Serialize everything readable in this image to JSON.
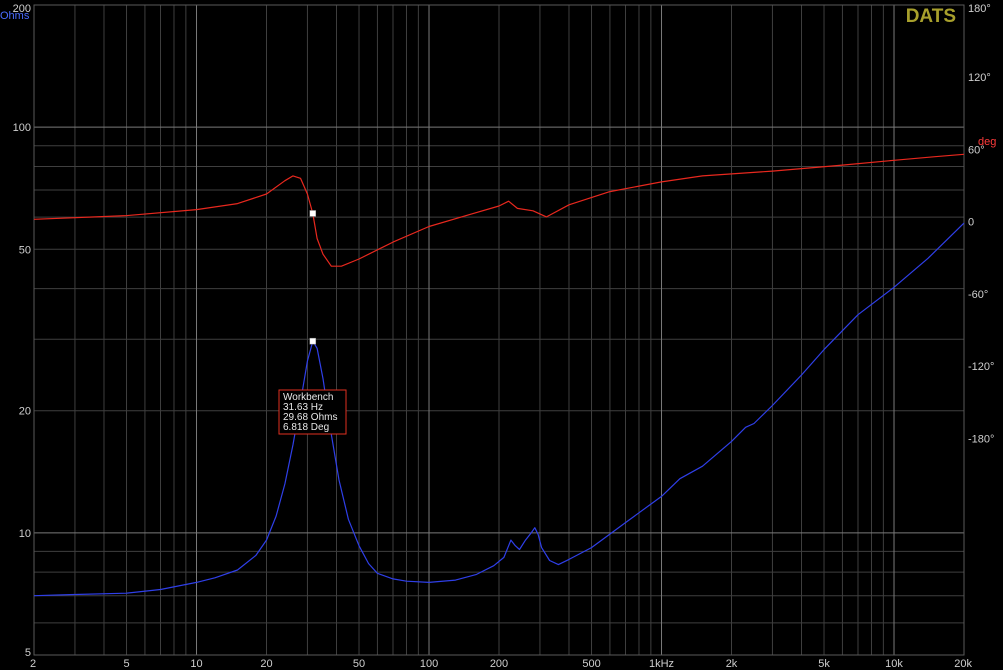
{
  "brand": "DATS",
  "units": {
    "left": "Ohms",
    "right": "deg"
  },
  "chart_data": {
    "type": "line",
    "xscale": "log",
    "xlim": [
      2,
      20000
    ],
    "x_ticks": [
      {
        "v": 2,
        "label": "2"
      },
      {
        "v": 5,
        "label": "5"
      },
      {
        "v": 10,
        "label": "10"
      },
      {
        "v": 20,
        "label": "20"
      },
      {
        "v": 50,
        "label": "50"
      },
      {
        "v": 100,
        "label": "100"
      },
      {
        "v": 200,
        "label": "200"
      },
      {
        "v": 500,
        "label": "500"
      },
      {
        "v": 1000,
        "label": "1kHz"
      },
      {
        "v": 2000,
        "label": "2k"
      },
      {
        "v": 5000,
        "label": "5k"
      },
      {
        "v": 10000,
        "label": "10k"
      },
      {
        "v": 20000,
        "label": "20k"
      }
    ],
    "y_left": {
      "scale": "log",
      "lim": [
        5,
        200
      ],
      "unit": "Ohms",
      "ticks": [
        {
          "v": 200,
          "label": "200"
        },
        {
          "v": 100,
          "label": "100"
        },
        {
          "v": 50,
          "label": "50"
        },
        {
          "v": 20,
          "label": "20"
        },
        {
          "v": 10,
          "label": "10"
        },
        {
          "v": 5,
          "label": "5"
        }
      ]
    },
    "y_right": {
      "scale": "linear",
      "lim": [
        -360,
        180
      ],
      "unit": "deg",
      "ticks": [
        {
          "v": 180,
          "label": "180°"
        },
        {
          "v": 120,
          "label": "120°"
        },
        {
          "v": 60,
          "label": "60°"
        },
        {
          "v": 0,
          "label": "0"
        },
        {
          "v": -60,
          "label": "-60°"
        },
        {
          "v": -120,
          "label": "-120°"
        },
        {
          "v": -180,
          "label": "-180°"
        }
      ]
    },
    "grid": true,
    "series": [
      {
        "name": "Impedance",
        "axis": "left",
        "color": "#2f3fe8",
        "points": [
          [
            2,
            7.0
          ],
          [
            3,
            7.05
          ],
          [
            5,
            7.1
          ],
          [
            7,
            7.25
          ],
          [
            10,
            7.55
          ],
          [
            12,
            7.75
          ],
          [
            15,
            8.1
          ],
          [
            18,
            8.8
          ],
          [
            20,
            9.6
          ],
          [
            22,
            11.0
          ],
          [
            24,
            13.2
          ],
          [
            26,
            16.5
          ],
          [
            28,
            21.0
          ],
          [
            30,
            26.5
          ],
          [
            31.63,
            29.68
          ],
          [
            33,
            28.5
          ],
          [
            35,
            24.0
          ],
          [
            38,
            17.5
          ],
          [
            41,
            13.5
          ],
          [
            45,
            10.8
          ],
          [
            50,
            9.3
          ],
          [
            55,
            8.4
          ],
          [
            60,
            7.95
          ],
          [
            70,
            7.7
          ],
          [
            80,
            7.6
          ],
          [
            100,
            7.55
          ],
          [
            130,
            7.65
          ],
          [
            160,
            7.9
          ],
          [
            190,
            8.3
          ],
          [
            210,
            8.7
          ],
          [
            225,
            9.6
          ],
          [
            235,
            9.3
          ],
          [
            245,
            9.1
          ],
          [
            260,
            9.6
          ],
          [
            275,
            10.0
          ],
          [
            285,
            10.3
          ],
          [
            295,
            9.9
          ],
          [
            305,
            9.2
          ],
          [
            330,
            8.55
          ],
          [
            360,
            8.35
          ],
          [
            400,
            8.6
          ],
          [
            500,
            9.2
          ],
          [
            700,
            10.6
          ],
          [
            1000,
            12.3
          ],
          [
            1200,
            13.6
          ],
          [
            1500,
            14.6
          ],
          [
            2000,
            16.8
          ],
          [
            2300,
            18.2
          ],
          [
            2500,
            18.6
          ],
          [
            3000,
            20.6
          ],
          [
            4000,
            24.5
          ],
          [
            5000,
            28.3
          ],
          [
            7000,
            34.5
          ],
          [
            10000,
            40.3
          ],
          [
            14000,
            47.5
          ],
          [
            20000,
            58.0
          ]
        ]
      },
      {
        "name": "Phase",
        "axis": "right",
        "color": "#e8281e",
        "points": [
          [
            2,
            2
          ],
          [
            5,
            5
          ],
          [
            10,
            10
          ],
          [
            15,
            15
          ],
          [
            20,
            23
          ],
          [
            24,
            34
          ],
          [
            26,
            38
          ],
          [
            28,
            36
          ],
          [
            30,
            23
          ],
          [
            31.63,
            6.8
          ],
          [
            33,
            -14
          ],
          [
            35,
            -27
          ],
          [
            38,
            -37
          ],
          [
            42,
            -37
          ],
          [
            50,
            -31
          ],
          [
            70,
            -17
          ],
          [
            100,
            -4
          ],
          [
            150,
            6
          ],
          [
            200,
            13
          ],
          [
            220,
            17
          ],
          [
            240,
            11
          ],
          [
            280,
            9
          ],
          [
            320,
            4
          ],
          [
            400,
            14
          ],
          [
            600,
            25
          ],
          [
            1000,
            33
          ],
          [
            1500,
            38
          ],
          [
            3000,
            42
          ],
          [
            6000,
            47
          ],
          [
            10000,
            51
          ],
          [
            15000,
            54
          ],
          [
            20000,
            56
          ]
        ]
      }
    ],
    "marker": {
      "label": "Workbench",
      "lines": [
        "31.63 Hz",
        "29.68 Ohms",
        "6.818 Deg"
      ],
      "freq": 31.63,
      "ohms": 29.68,
      "deg": 6.818,
      "border_color": "#e03020"
    }
  }
}
